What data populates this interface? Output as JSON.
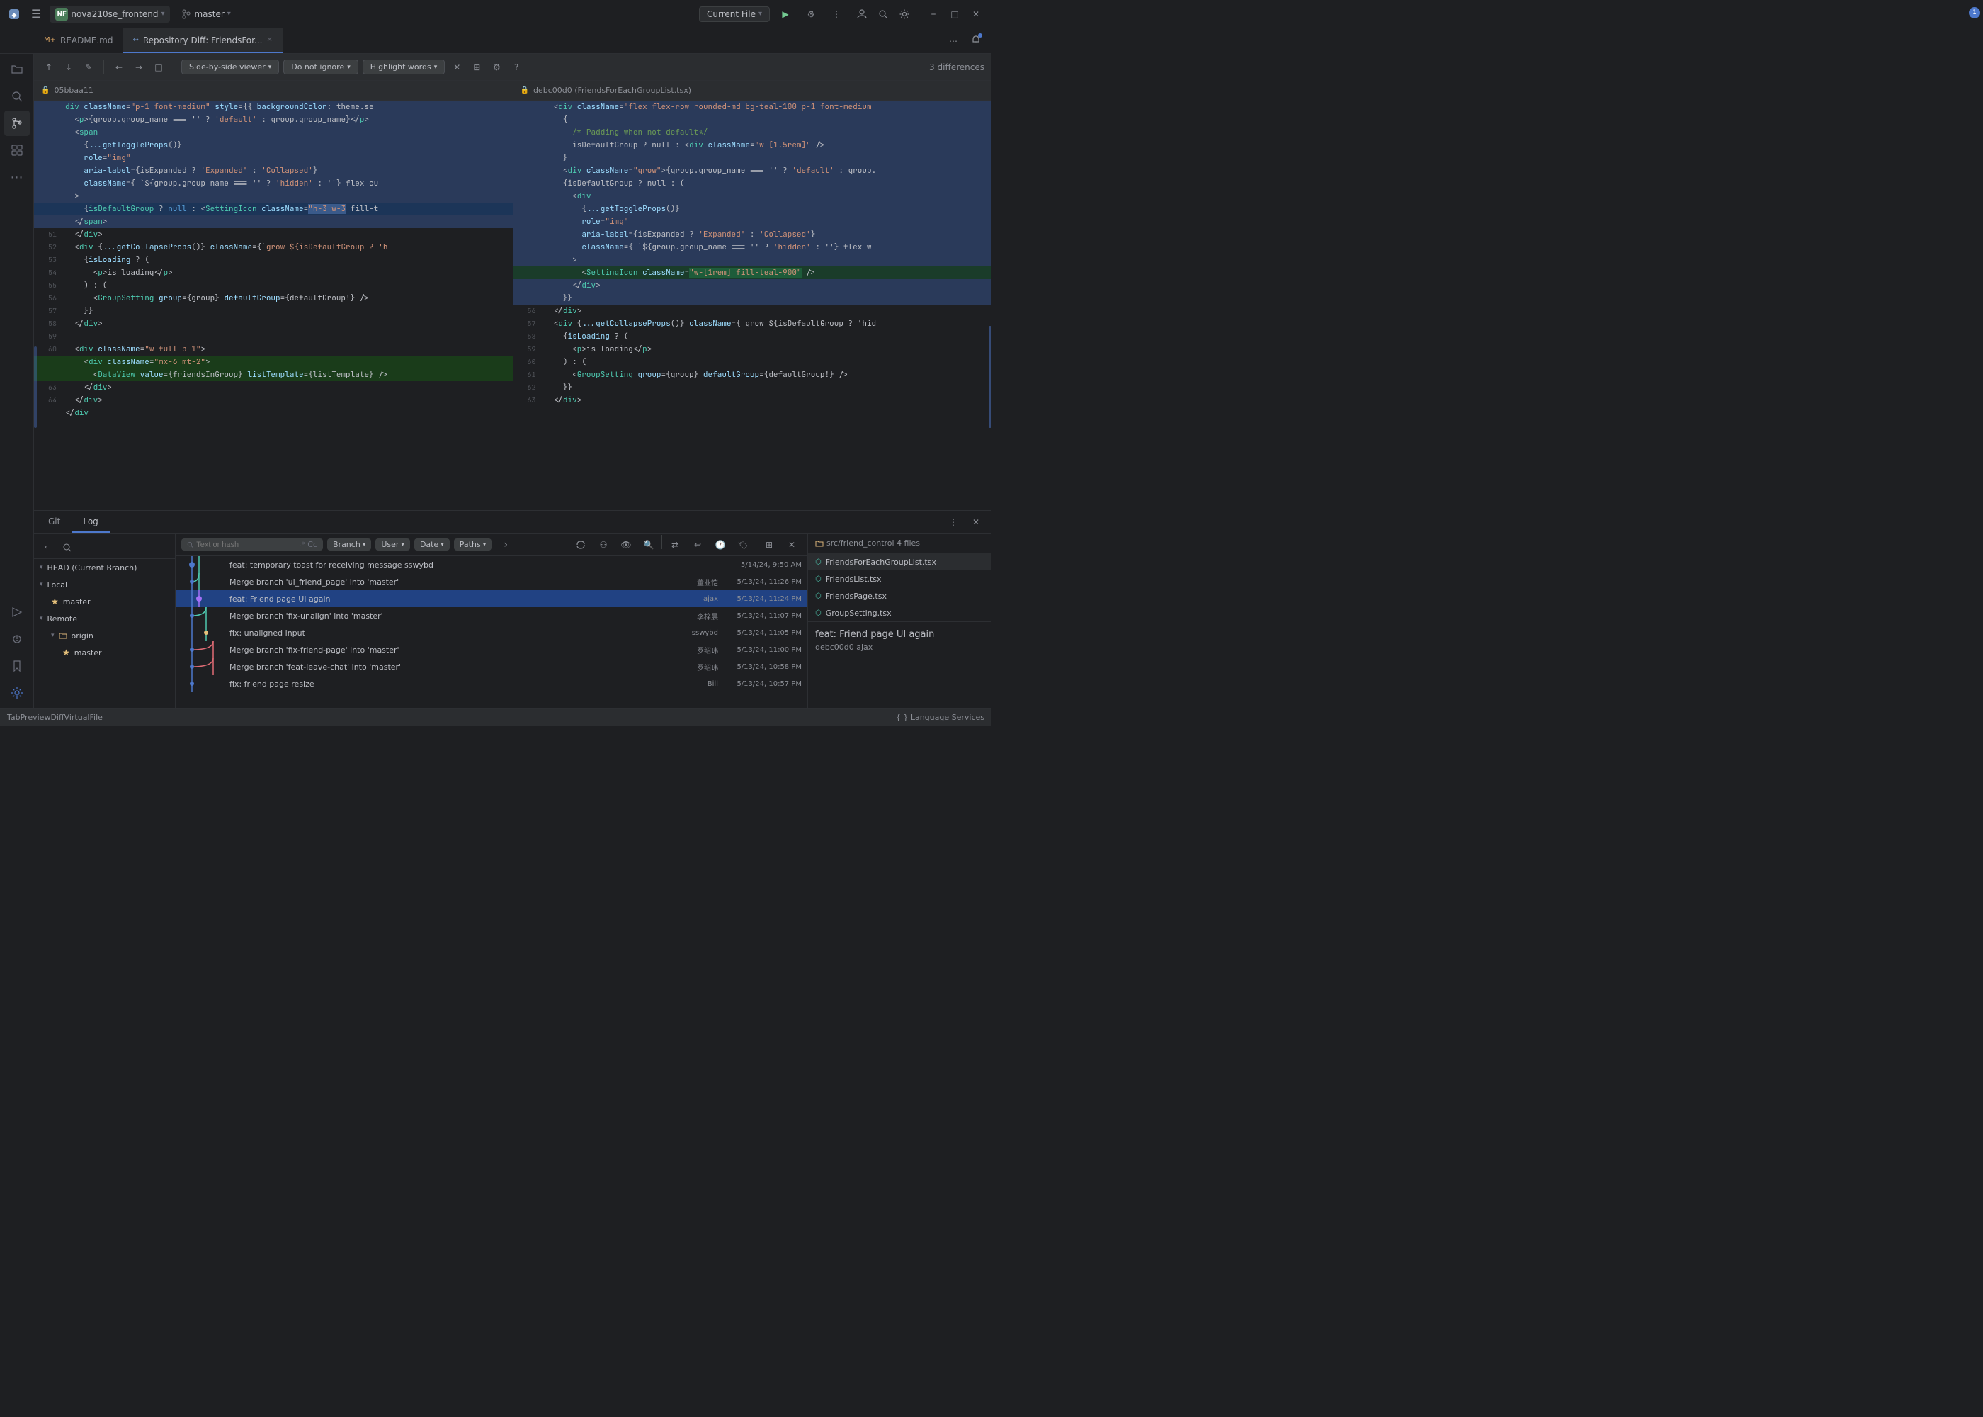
{
  "titlebar": {
    "logo": "◆",
    "menu_icon": "☰",
    "project_name": "nova210se_frontend",
    "branch_name": "master",
    "file_selector_label": "Current File",
    "run_btn": "▶",
    "debug_btn": "⚙",
    "more_btn": "⋮",
    "user_btn": "👤",
    "search_btn": "🔍",
    "settings_btn": "⚙",
    "minimize": "–",
    "maximize": "□",
    "close": "✕"
  },
  "tabs": [
    {
      "id": "readme",
      "icon": "M+",
      "label": "README.md",
      "active": false,
      "modified": false
    },
    {
      "id": "diff",
      "icon": "↔",
      "label": "Repository Diff: FriendsFor...",
      "active": true,
      "modified": true
    }
  ],
  "diff_toolbar": {
    "nav_up": "↑",
    "nav_down": "↓",
    "edit_btn": "✎",
    "nav_back": "←",
    "nav_fwd": "→",
    "view_source": "□",
    "view_mode": "Side-by-side viewer",
    "ignore_mode": "Do not ignore",
    "highlight_words": "Highlight words",
    "close_btn": "✕",
    "expand_btn": "⊞",
    "settings_btn": "⚙",
    "help_btn": "?",
    "diff_count": "3 differences"
  },
  "left_pane": {
    "header": "05bbaa11",
    "lines": [
      {
        "num": "",
        "content": "      <div className=\"p-1 font-medium\" style={{ backgroundColor: theme.se",
        "type": "highlight"
      },
      {
        "num": "",
        "content": "        <p>{group.group_name === '' ? 'default' : group.group_name}</p>",
        "type": "highlight"
      },
      {
        "num": "",
        "content": "        <span",
        "type": "highlight"
      },
      {
        "num": "",
        "content": "          {...getToggleProps()}",
        "type": "highlight"
      },
      {
        "num": "",
        "content": "          role=\"img\"",
        "type": "highlight"
      },
      {
        "num": "",
        "content": "          aria-label={isExpanded ? 'Expanded' : 'Collapsed'}",
        "type": "highlight"
      },
      {
        "num": "",
        "content": "          className={ `${group.group_name === '' ? 'hidden' : ''} flex cu",
        "type": "highlight"
      },
      {
        "num": "",
        "content": "        >",
        "type": "highlight"
      },
      {
        "num": "",
        "content": "          {isDefaultGroup ? null : <SettingIcon className=\"h-3 w-3 fill-t",
        "type": "selected"
      },
      {
        "num": "",
        "content": "        </span>",
        "type": "highlight"
      },
      {
        "num": "51",
        "content": "        </div>",
        "type": "normal"
      },
      {
        "num": "52",
        "content": "        <div {...getCollapseProps()} className={`grow ${isDefaultGroup ? 'h",
        "type": "normal"
      },
      {
        "num": "53",
        "content": "          {isLoading ? (",
        "type": "normal"
      },
      {
        "num": "54",
        "content": "            <p>is loading</p>",
        "type": "normal"
      },
      {
        "num": "55",
        "content": "          ) : (",
        "type": "normal"
      },
      {
        "num": "56",
        "content": "            <GroupSetting group={group} defaultGroup={defaultGroup!} />",
        "type": "normal"
      },
      {
        "num": "57",
        "content": "          }}",
        "type": "normal"
      },
      {
        "num": "58",
        "content": "        </div>",
        "type": "normal"
      },
      {
        "num": "59",
        "content": "",
        "type": "normal"
      },
      {
        "num": "60",
        "content": "        <div className=\"w-full p-1\">",
        "type": "normal"
      },
      {
        "num": "",
        "content": "          <div className=\"mx-6 mt-2\">",
        "type": "added"
      },
      {
        "num": "",
        "content": "            <DataView value={friendsInGroup} listTemplate={listTemplate} />",
        "type": "added"
      },
      {
        "num": "63",
        "content": "          </div>",
        "type": "normal"
      },
      {
        "num": "64",
        "content": "        </div>",
        "type": "normal"
      },
      {
        "num": "",
        "content": "      </div",
        "type": "normal"
      }
    ]
  },
  "right_pane": {
    "header": "debc00d0 (FriendsForEachGroupList.tsx)",
    "lines": [
      {
        "num": "",
        "content": "      <div className=\"flex flex-row rounded-md bg-teal-100 p-1 font-medium",
        "type": "highlight"
      },
      {
        "num": "",
        "content": "        {",
        "type": "highlight"
      },
      {
        "num": "",
        "content": "          /* Padding when not default*/",
        "type": "highlight"
      },
      {
        "num": "",
        "content": "          isDefaultGroup ? null : <div className=\"w-[1.5rem]\" />",
        "type": "highlight"
      },
      {
        "num": "",
        "content": "        }",
        "type": "highlight"
      },
      {
        "num": "",
        "content": "        <div className=\"grow\">{group.group_name === '' ? 'default' : group.",
        "type": "highlight"
      },
      {
        "num": "",
        "content": "        {isDefaultGroup ? null : (",
        "type": "highlight"
      },
      {
        "num": "",
        "content": "          <div",
        "type": "highlight"
      },
      {
        "num": "",
        "content": "            {...getToggleProps()}",
        "type": "highlight"
      },
      {
        "num": "",
        "content": "            role=\"img\"",
        "type": "highlight"
      },
      {
        "num": "",
        "content": "            aria-label={isExpanded ? 'Expanded' : 'Collapsed'}",
        "type": "highlight"
      },
      {
        "num": "",
        "content": "            className={ `${group.group_name === '' ? 'hidden' : ''} flex w",
        "type": "highlight"
      },
      {
        "num": "",
        "content": "          >",
        "type": "highlight"
      },
      {
        "num": "",
        "content": "            <SettingIcon className=\"w-[1rem] fill-teal-900\" />",
        "type": "selected"
      },
      {
        "num": "",
        "content": "          </div>",
        "type": "highlight"
      },
      {
        "num": "",
        "content": "        }}",
        "type": "highlight"
      },
      {
        "num": "56",
        "content": "        </div>",
        "type": "normal"
      },
      {
        "num": "57",
        "content": "        <div {...getCollapseProps()} className={ grow ${isDefaultGroup ? 'hid",
        "type": "normal"
      },
      {
        "num": "58",
        "content": "          {isLoading ? (",
        "type": "normal"
      },
      {
        "num": "59",
        "content": "            <p>is loading</p>",
        "type": "normal"
      },
      {
        "num": "60",
        "content": "          ) : (",
        "type": "normal"
      },
      {
        "num": "61",
        "content": "            <GroupSetting group={group} defaultGroup={defaultGroup!} />",
        "type": "normal"
      },
      {
        "num": "62",
        "content": "          }}",
        "type": "normal"
      },
      {
        "num": "63",
        "content": "        </div>",
        "type": "normal"
      }
    ]
  },
  "git_panel": {
    "tabs": [
      "Git",
      "Log"
    ],
    "active_tab": "Log",
    "toolbar": {
      "search_placeholder": "Text or hash",
      "branch_filter": "Branch",
      "user_filter": "User",
      "date_filter": "Date",
      "paths_filter": "Paths"
    },
    "tree": {
      "head": "HEAD (Current Branch)",
      "local_label": "Local",
      "branches": [
        {
          "name": "master",
          "type": "local",
          "level": 1
        }
      ],
      "remote_label": "Remote",
      "remote_branches": [
        {
          "name": "origin",
          "level": 1
        },
        {
          "name": "master",
          "level": 2,
          "starred": true
        }
      ]
    },
    "commits": [
      {
        "msg": "feat: temporary toast for receiving message sswybd",
        "author": "",
        "date": "5/14/24, 9:50 AM",
        "selected": false,
        "dot_color": "#4d78cc"
      },
      {
        "msg": "Merge branch 'ui_friend_page' into 'master'",
        "author": "董业恺",
        "date": "5/13/24, 11:26 PM",
        "selected": false,
        "dot_color": "#4d78cc"
      },
      {
        "msg": "feat: Friend page UI again",
        "author": "ajax",
        "date": "5/13/24, 11:24 PM",
        "selected": true,
        "dot_color": "#a371f7"
      },
      {
        "msg": "Merge branch 'fix-unalign' into 'master'",
        "author": "李梓晨",
        "date": "5/13/24, 11:07 PM",
        "selected": false,
        "dot_color": "#4d78cc"
      },
      {
        "msg": "fix: unaligned input",
        "author": "sswybd",
        "date": "5/13/24, 11:05 PM",
        "selected": false,
        "dot_color": "#4d78cc"
      },
      {
        "msg": "Merge branch 'fix-friend-page' into 'master'",
        "author": "罗绍玮",
        "date": "5/13/24, 11:00 PM",
        "selected": false,
        "dot_color": "#4d78cc"
      },
      {
        "msg": "Merge branch 'feat-leave-chat' into 'master'",
        "author": "罗绍玮",
        "date": "5/13/24, 10:58 PM",
        "selected": false,
        "dot_color": "#4d78cc"
      },
      {
        "msg": "fix: friend page resize",
        "author": "Bill",
        "date": "5/13/24, 10:57 PM",
        "selected": false,
        "dot_color": "#4d78cc"
      }
    ],
    "files_header": "src/friend_control  4 files",
    "files": [
      {
        "name": "FriendsForEachGroupList.tsx",
        "selected": true
      },
      {
        "name": "FriendsList.tsx",
        "selected": false
      },
      {
        "name": "FriendsPage.tsx",
        "selected": false
      },
      {
        "name": "GroupSetting.tsx",
        "selected": false
      }
    ],
    "commit_title": "feat: Friend page UI again",
    "commit_sub": "debc00d0  ajax"
  },
  "statusbar": {
    "left": "TabPreviewDiffVirtualFile",
    "right": "{ } Language Services"
  }
}
